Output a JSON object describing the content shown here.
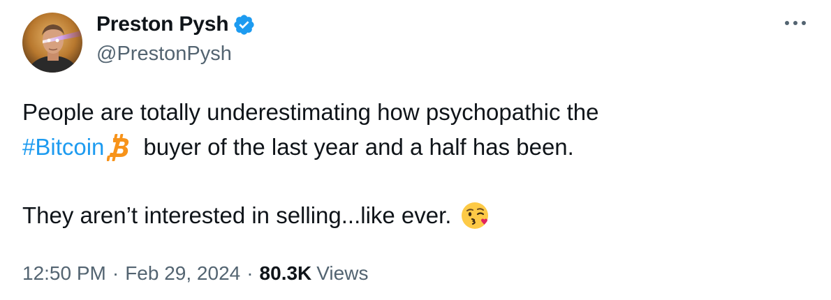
{
  "author": {
    "display_name": "Preston Pysh",
    "handle": "@PrestonPysh",
    "verified": true,
    "avatar_icon": "profile-photo-laser-eyes"
  },
  "tweet": {
    "line1": "People are totally underestimating how psychopathic the",
    "hashtag": "#Bitcoin",
    "hashtag_icon": "bitcoin-icon",
    "line2_rest": "buyer of the last year and a half has been.",
    "line3": "They aren’t interested in selling...like ever.",
    "emoji_icon": "face-blowing-kiss-emoji"
  },
  "meta": {
    "time": "12:50 PM",
    "separator": "·",
    "date": "Feb 29, 2024",
    "views_count": "80.3K",
    "views_label": "Views"
  },
  "colors": {
    "accent": "#1d9bf0",
    "text_primary": "#0f1419",
    "text_secondary": "#536471",
    "bitcoin_orange": "#f7931a"
  },
  "icons": {
    "verified": "verified-badge-icon",
    "more": "more-options-icon"
  }
}
